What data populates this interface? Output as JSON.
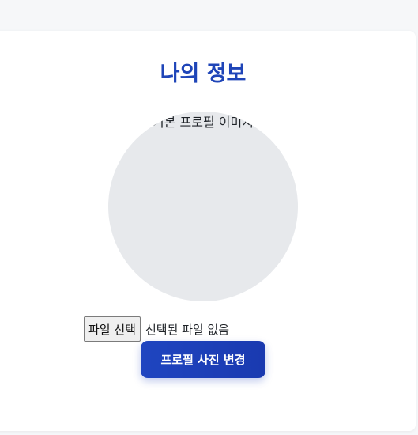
{
  "page": {
    "title": "나의 정보"
  },
  "profile": {
    "image_alt": "기본 프로필 이미지"
  },
  "file_input": {
    "button_label": "파일 선택",
    "status_text": "선택된 파일 없음"
  },
  "actions": {
    "change_photo_label": "프로필 사진 변경"
  },
  "colors": {
    "accent": "#1f45b8",
    "avatar_bg": "#e7e9ec",
    "page_bg": "#f6f7f9"
  }
}
